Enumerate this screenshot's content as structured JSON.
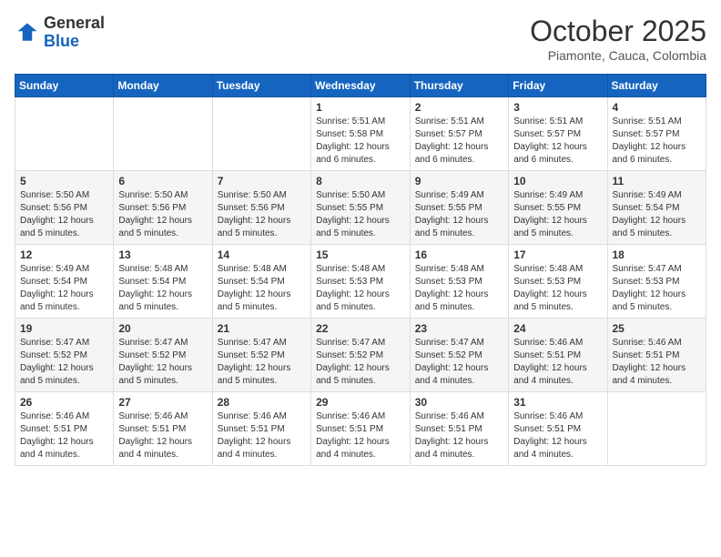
{
  "logo": {
    "general": "General",
    "blue": "Blue"
  },
  "header": {
    "month": "October 2025",
    "location": "Piamonte, Cauca, Colombia"
  },
  "weekdays": [
    "Sunday",
    "Monday",
    "Tuesday",
    "Wednesday",
    "Thursday",
    "Friday",
    "Saturday"
  ],
  "weeks": [
    [
      {
        "day": "",
        "info": ""
      },
      {
        "day": "",
        "info": ""
      },
      {
        "day": "",
        "info": ""
      },
      {
        "day": "1",
        "info": "Sunrise: 5:51 AM\nSunset: 5:58 PM\nDaylight: 12 hours\nand 6 minutes."
      },
      {
        "day": "2",
        "info": "Sunrise: 5:51 AM\nSunset: 5:57 PM\nDaylight: 12 hours\nand 6 minutes."
      },
      {
        "day": "3",
        "info": "Sunrise: 5:51 AM\nSunset: 5:57 PM\nDaylight: 12 hours\nand 6 minutes."
      },
      {
        "day": "4",
        "info": "Sunrise: 5:51 AM\nSunset: 5:57 PM\nDaylight: 12 hours\nand 6 minutes."
      }
    ],
    [
      {
        "day": "5",
        "info": "Sunrise: 5:50 AM\nSunset: 5:56 PM\nDaylight: 12 hours\nand 5 minutes."
      },
      {
        "day": "6",
        "info": "Sunrise: 5:50 AM\nSunset: 5:56 PM\nDaylight: 12 hours\nand 5 minutes."
      },
      {
        "day": "7",
        "info": "Sunrise: 5:50 AM\nSunset: 5:56 PM\nDaylight: 12 hours\nand 5 minutes."
      },
      {
        "day": "8",
        "info": "Sunrise: 5:50 AM\nSunset: 5:55 PM\nDaylight: 12 hours\nand 5 minutes."
      },
      {
        "day": "9",
        "info": "Sunrise: 5:49 AM\nSunset: 5:55 PM\nDaylight: 12 hours\nand 5 minutes."
      },
      {
        "day": "10",
        "info": "Sunrise: 5:49 AM\nSunset: 5:55 PM\nDaylight: 12 hours\nand 5 minutes."
      },
      {
        "day": "11",
        "info": "Sunrise: 5:49 AM\nSunset: 5:54 PM\nDaylight: 12 hours\nand 5 minutes."
      }
    ],
    [
      {
        "day": "12",
        "info": "Sunrise: 5:49 AM\nSunset: 5:54 PM\nDaylight: 12 hours\nand 5 minutes."
      },
      {
        "day": "13",
        "info": "Sunrise: 5:48 AM\nSunset: 5:54 PM\nDaylight: 12 hours\nand 5 minutes."
      },
      {
        "day": "14",
        "info": "Sunrise: 5:48 AM\nSunset: 5:54 PM\nDaylight: 12 hours\nand 5 minutes."
      },
      {
        "day": "15",
        "info": "Sunrise: 5:48 AM\nSunset: 5:53 PM\nDaylight: 12 hours\nand 5 minutes."
      },
      {
        "day": "16",
        "info": "Sunrise: 5:48 AM\nSunset: 5:53 PM\nDaylight: 12 hours\nand 5 minutes."
      },
      {
        "day": "17",
        "info": "Sunrise: 5:48 AM\nSunset: 5:53 PM\nDaylight: 12 hours\nand 5 minutes."
      },
      {
        "day": "18",
        "info": "Sunrise: 5:47 AM\nSunset: 5:53 PM\nDaylight: 12 hours\nand 5 minutes."
      }
    ],
    [
      {
        "day": "19",
        "info": "Sunrise: 5:47 AM\nSunset: 5:52 PM\nDaylight: 12 hours\nand 5 minutes."
      },
      {
        "day": "20",
        "info": "Sunrise: 5:47 AM\nSunset: 5:52 PM\nDaylight: 12 hours\nand 5 minutes."
      },
      {
        "day": "21",
        "info": "Sunrise: 5:47 AM\nSunset: 5:52 PM\nDaylight: 12 hours\nand 5 minutes."
      },
      {
        "day": "22",
        "info": "Sunrise: 5:47 AM\nSunset: 5:52 PM\nDaylight: 12 hours\nand 5 minutes."
      },
      {
        "day": "23",
        "info": "Sunrise: 5:47 AM\nSunset: 5:52 PM\nDaylight: 12 hours\nand 4 minutes."
      },
      {
        "day": "24",
        "info": "Sunrise: 5:46 AM\nSunset: 5:51 PM\nDaylight: 12 hours\nand 4 minutes."
      },
      {
        "day": "25",
        "info": "Sunrise: 5:46 AM\nSunset: 5:51 PM\nDaylight: 12 hours\nand 4 minutes."
      }
    ],
    [
      {
        "day": "26",
        "info": "Sunrise: 5:46 AM\nSunset: 5:51 PM\nDaylight: 12 hours\nand 4 minutes."
      },
      {
        "day": "27",
        "info": "Sunrise: 5:46 AM\nSunset: 5:51 PM\nDaylight: 12 hours\nand 4 minutes."
      },
      {
        "day": "28",
        "info": "Sunrise: 5:46 AM\nSunset: 5:51 PM\nDaylight: 12 hours\nand 4 minutes."
      },
      {
        "day": "29",
        "info": "Sunrise: 5:46 AM\nSunset: 5:51 PM\nDaylight: 12 hours\nand 4 minutes."
      },
      {
        "day": "30",
        "info": "Sunrise: 5:46 AM\nSunset: 5:51 PM\nDaylight: 12 hours\nand 4 minutes."
      },
      {
        "day": "31",
        "info": "Sunrise: 5:46 AM\nSunset: 5:51 PM\nDaylight: 12 hours\nand 4 minutes."
      },
      {
        "day": "",
        "info": ""
      }
    ]
  ]
}
